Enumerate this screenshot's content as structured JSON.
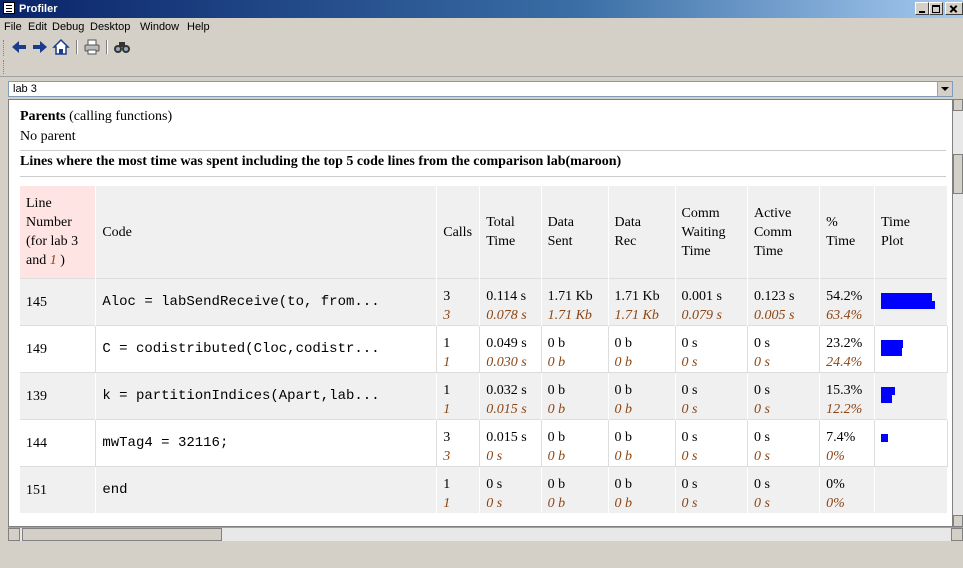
{
  "window": {
    "title": "Profiler"
  },
  "menu": [
    "File",
    "Edit",
    "Debug",
    "Desktop",
    "Window",
    "Help"
  ],
  "toolbar": {
    "icons": [
      "back-arrow-icon",
      "forward-arrow-icon",
      "home-icon",
      "print-icon",
      "find-icon"
    ],
    "location_value": "lab 3"
  },
  "parents": {
    "title_bold": "Parents",
    "title_rest": " (calling functions)",
    "value": "No parent"
  },
  "lines_heading": "Lines where the most time was spent including the top 5 code lines from the comparison lab(maroon)",
  "table": {
    "headers": {
      "line": [
        "Line",
        "Number",
        "(for lab 3",
        "and "
      ],
      "line_italic": "1",
      "line_close": " )",
      "code": "Code",
      "calls": "Calls",
      "total_time": [
        "Total",
        "Time"
      ],
      "data_sent": [
        "Data",
        "Sent"
      ],
      "data_rec": [
        "Data",
        "Rec"
      ],
      "comm_waiting": [
        "Comm",
        "Waiting",
        "Time"
      ],
      "active_comm": [
        "Active",
        "Comm",
        "Time"
      ],
      "pct_time": [
        "%",
        "Time"
      ],
      "time_plot": [
        "Time",
        "Plot"
      ]
    },
    "rows": [
      {
        "line": "145",
        "code": "Aloc = labSendReceive(to, from...",
        "calls": "3",
        "calls_cmp": "3",
        "total": "0.114 s",
        "total_cmp": "0.078 s",
        "sent": "1.71 Kb",
        "sent_cmp": "1.71 Kb",
        "rec": "1.71 Kb",
        "rec_cmp": "1.71 Kb",
        "wait": "0.001 s",
        "wait_cmp": "0.079 s",
        "active": "0.123 s",
        "active_cmp": "0.005 s",
        "pct": "54.2%",
        "pct_cmp": "63.4%",
        "plot": [
          0.542,
          0.634
        ]
      },
      {
        "line": "149",
        "code": "C = codistributed(Cloc,codistr...",
        "calls": "1",
        "calls_cmp": "1",
        "total": "0.049 s",
        "total_cmp": "0.030 s",
        "sent": "0 b",
        "sent_cmp": "0 b",
        "rec": "0 b",
        "rec_cmp": "0 b",
        "wait": "0 s",
        "wait_cmp": "0 s",
        "active": "0 s",
        "active_cmp": "0 s",
        "pct": "23.2%",
        "pct_cmp": "24.4%",
        "plot": [
          0.232,
          0.244
        ]
      },
      {
        "line": "139",
        "code": "k = partitionIndices(Apart,lab...",
        "calls": "1",
        "calls_cmp": "1",
        "total": "0.032 s",
        "total_cmp": "0.015 s",
        "sent": "0 b",
        "sent_cmp": "0 b",
        "rec": "0 b",
        "rec_cmp": "0 b",
        "wait": "0 s",
        "wait_cmp": "0 s",
        "active": "0 s",
        "active_cmp": "0 s",
        "pct": "15.3%",
        "pct_cmp": "12.2%",
        "plot": [
          0.153,
          0.122
        ]
      },
      {
        "line": "144",
        "code": "mwTag4 = 32116;",
        "calls": "3",
        "calls_cmp": "3",
        "total": "0.015 s",
        "total_cmp": "0 s",
        "sent": "0 b",
        "sent_cmp": "0 b",
        "rec": "0 b",
        "rec_cmp": "0 b",
        "wait": "0 s",
        "wait_cmp": "0 s",
        "active": "0 s",
        "active_cmp": "0 s",
        "pct": "7.4%",
        "pct_cmp": "0%",
        "plot": [
          0.074,
          0.0
        ]
      },
      {
        "line": "151",
        "code": "end",
        "calls": "1",
        "calls_cmp": "1",
        "total": "0 s",
        "total_cmp": "0 s",
        "sent": "0 b",
        "sent_cmp": "0 b",
        "rec": "0 b",
        "rec_cmp": "0 b",
        "wait": "0 s",
        "wait_cmp": "0 s",
        "active": "0 s",
        "active_cmp": "0 s",
        "pct": "0%",
        "pct_cmp": "0%",
        "plot": [
          0,
          0
        ]
      }
    ]
  },
  "colors": {
    "plot_bar": "#0000ff",
    "comparison_text": "#8b4513",
    "line_header_bg": "#ffe4e4"
  }
}
